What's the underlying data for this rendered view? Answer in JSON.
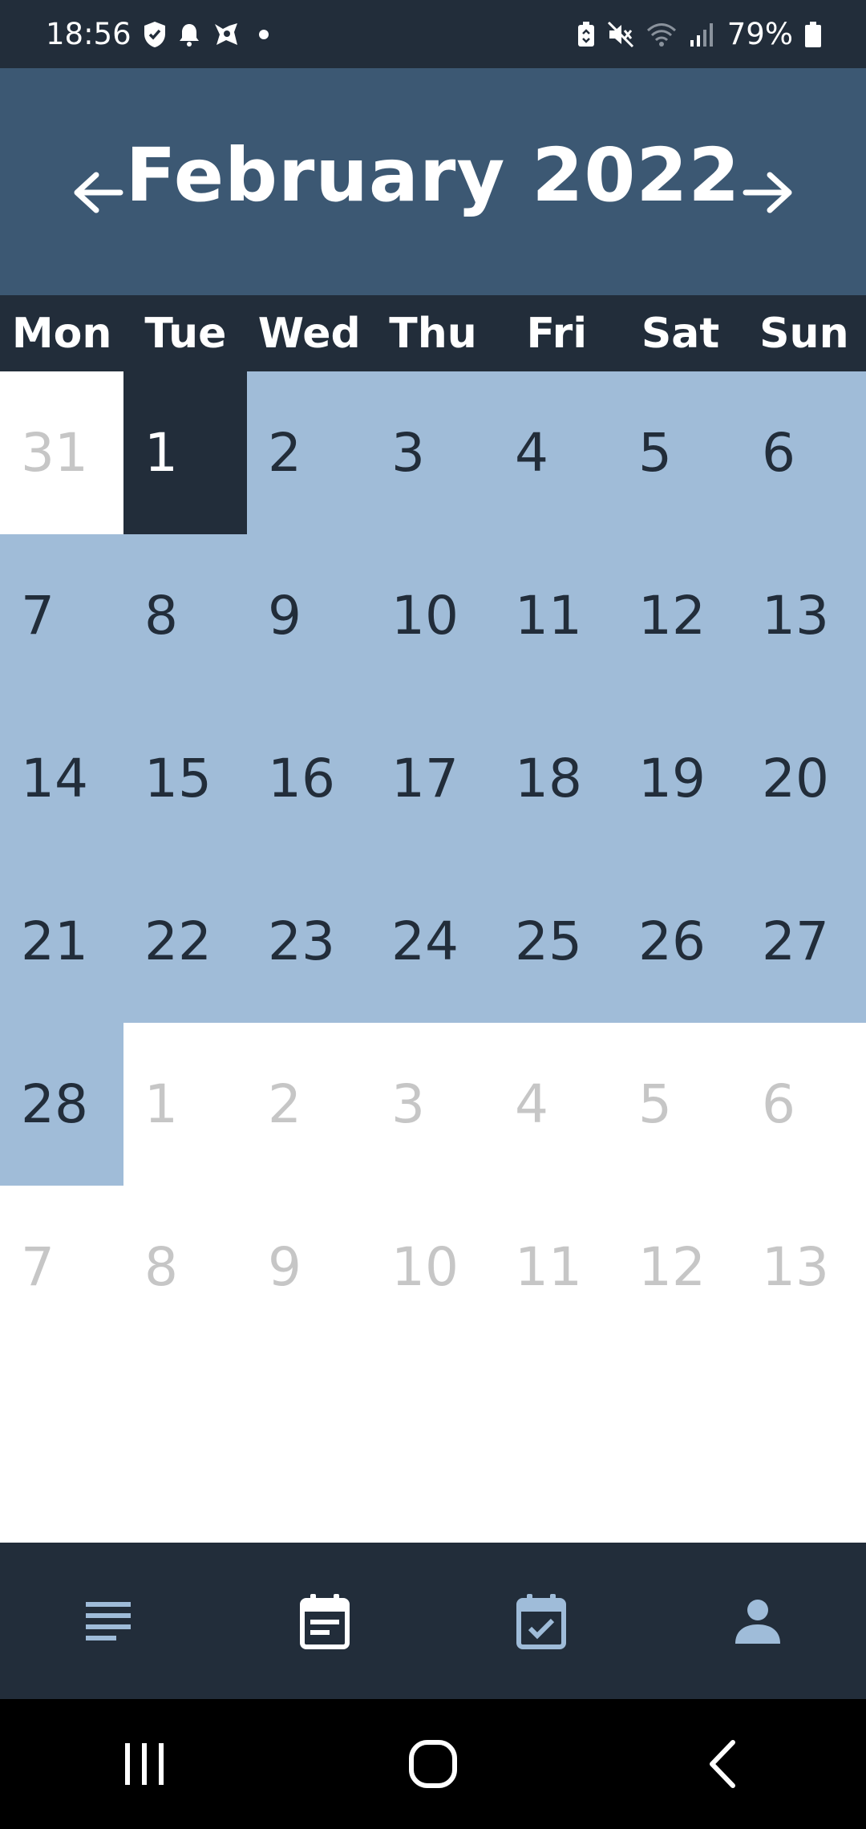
{
  "status_bar": {
    "time": "18:56",
    "battery_percent": "79%",
    "left_icons": [
      "shield-check-icon",
      "bell-icon",
      "app-notification-icon",
      "dot-icon"
    ],
    "right_icons": [
      "battery-saver-icon",
      "mute-icon",
      "wifi-icon",
      "signal-icon",
      "battery-icon"
    ]
  },
  "header": {
    "title": "February 2022",
    "prev_icon": "arrow-left-icon",
    "next_icon": "arrow-right-icon"
  },
  "weekdays": [
    "Mon",
    "Tue",
    "Wed",
    "Thu",
    "Fri",
    "Sat",
    "Sun"
  ],
  "calendar": {
    "today": "1",
    "days": [
      {
        "label": "31",
        "state": "inactive"
      },
      {
        "label": "1",
        "state": "today"
      },
      {
        "label": "2",
        "state": "active"
      },
      {
        "label": "3",
        "state": "active"
      },
      {
        "label": "4",
        "state": "active"
      },
      {
        "label": "5",
        "state": "active"
      },
      {
        "label": "6",
        "state": "active"
      },
      {
        "label": "7",
        "state": "active"
      },
      {
        "label": "8",
        "state": "active"
      },
      {
        "label": "9",
        "state": "active"
      },
      {
        "label": "10",
        "state": "active"
      },
      {
        "label": "11",
        "state": "active"
      },
      {
        "label": "12",
        "state": "active"
      },
      {
        "label": "13",
        "state": "active"
      },
      {
        "label": "14",
        "state": "active"
      },
      {
        "label": "15",
        "state": "active"
      },
      {
        "label": "16",
        "state": "active"
      },
      {
        "label": "17",
        "state": "active"
      },
      {
        "label": "18",
        "state": "active"
      },
      {
        "label": "19",
        "state": "active"
      },
      {
        "label": "20",
        "state": "active"
      },
      {
        "label": "21",
        "state": "active"
      },
      {
        "label": "22",
        "state": "active"
      },
      {
        "label": "23",
        "state": "active"
      },
      {
        "label": "24",
        "state": "active"
      },
      {
        "label": "25",
        "state": "active"
      },
      {
        "label": "26",
        "state": "active"
      },
      {
        "label": "27",
        "state": "active"
      },
      {
        "label": "28",
        "state": "active"
      },
      {
        "label": "1",
        "state": "inactive"
      },
      {
        "label": "2",
        "state": "inactive"
      },
      {
        "label": "3",
        "state": "inactive"
      },
      {
        "label": "4",
        "state": "inactive"
      },
      {
        "label": "5",
        "state": "inactive"
      },
      {
        "label": "6",
        "state": "inactive"
      },
      {
        "label": "7",
        "state": "inactive"
      },
      {
        "label": "8",
        "state": "inactive"
      },
      {
        "label": "9",
        "state": "inactive"
      },
      {
        "label": "10",
        "state": "inactive"
      },
      {
        "label": "11",
        "state": "inactive"
      },
      {
        "label": "12",
        "state": "inactive"
      },
      {
        "label": "13",
        "state": "inactive"
      }
    ]
  },
  "bottom_nav": {
    "items": [
      {
        "icon": "list-icon",
        "selected": false
      },
      {
        "icon": "calendar-month-icon",
        "selected": true
      },
      {
        "icon": "calendar-check-icon",
        "selected": false
      },
      {
        "icon": "person-icon",
        "selected": false
      }
    ]
  },
  "system_nav": {
    "items": [
      "recent-apps-icon",
      "home-icon",
      "back-icon"
    ]
  },
  "colors": {
    "dark": "#222d3a",
    "header": "#3c5873",
    "active_day": "#a0bcd8",
    "inactive_text": "#c6c6c6",
    "nav_icon": "#9fbcd9"
  }
}
